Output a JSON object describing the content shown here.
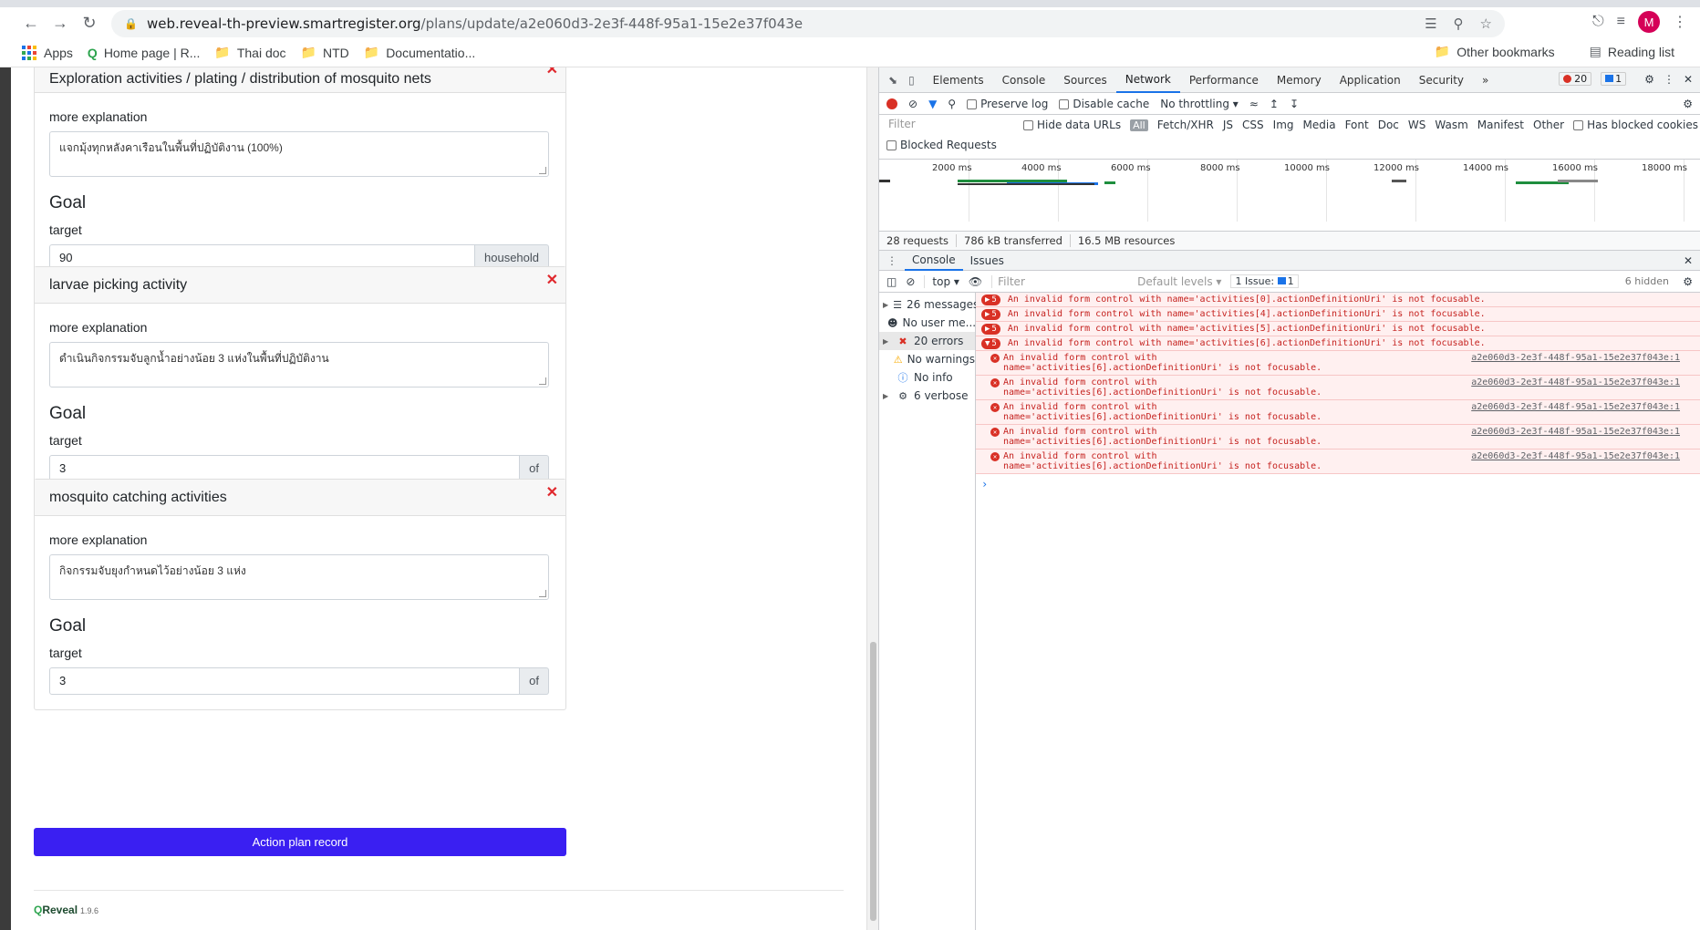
{
  "browser": {
    "url_host": "web.reveal-th-preview.smartregister.org",
    "url_path": "/plans/update/a2e060d3-2e3f-448f-95a1-15e2e37f043e",
    "profile_initial": "M",
    "bookmarks": [
      "Apps",
      "Home page | R...",
      "Thai doc",
      "NTD",
      "Documentatio..."
    ],
    "other_bookmarks": "Other bookmarks",
    "reading_list": "Reading list"
  },
  "page": {
    "activities": [
      {
        "title": "Exploration activities / plating / distribution of mosquito nets",
        "explanation_label": "more explanation",
        "explanation": "แจกมุ้งทุกหลังคาเรือนในพื้นที่ปฏิบัติงาน (100%)",
        "goal_label": "Goal",
        "target_label": "target",
        "target_value": "90",
        "unit": "household"
      },
      {
        "title": "larvae picking activity",
        "explanation_label": "more explanation",
        "explanation": "ดำเนินกิจกรรมจับลูกน้ำอย่างน้อย 3 แห่งในพื้นที่ปฏิบัติงาน",
        "goal_label": "Goal",
        "target_label": "target",
        "target_value": "3",
        "unit": "of"
      },
      {
        "title": "mosquito catching activities",
        "explanation_label": "more explanation",
        "explanation": "กิจกรรมจับยุงกำหนดไว้อย่างน้อย 3 แห่ง",
        "goal_label": "Goal",
        "target_label": "target",
        "target_value": "3",
        "unit": "of"
      }
    ],
    "submit_label": "Action plan record",
    "brand": "Reveal",
    "version": "1.9.6"
  },
  "devtools": {
    "tabs": [
      "Elements",
      "Console",
      "Sources",
      "Network",
      "Performance",
      "Memory",
      "Application",
      "Security"
    ],
    "active_tab": "Network",
    "error_count": "20",
    "message_count": "1",
    "network": {
      "preserve_log": "Preserve log",
      "disable_cache": "Disable cache",
      "throttling": "No throttling",
      "filter_placeholder": "Filter",
      "hide_data_urls": "Hide data URLs",
      "types": [
        "All",
        "Fetch/XHR",
        "JS",
        "CSS",
        "Img",
        "Media",
        "Font",
        "Doc",
        "WS",
        "Wasm",
        "Manifest",
        "Other"
      ],
      "has_blocked_cookies": "Has blocked cookies",
      "blocked_requests": "Blocked Requests",
      "timeline_labels": [
        "2000 ms",
        "4000 ms",
        "6000 ms",
        "8000 ms",
        "10000 ms",
        "12000 ms",
        "14000 ms",
        "16000 ms",
        "18000 ms"
      ],
      "requests": "28 requests",
      "transferred": "786 kB transferred",
      "resources": "16.5 MB resources"
    },
    "drawer_tabs": [
      "Console",
      "Issues"
    ],
    "console": {
      "context": "top",
      "filter_placeholder": "Filter",
      "levels": "Default levels",
      "issues": "1 Issue:",
      "issues_count": "1",
      "hidden": "6 hidden",
      "sidebar": [
        "26 messages",
        "No user me...",
        "20 errors",
        "No warnings",
        "No info",
        "6 verbose"
      ],
      "groups": [
        {
          "count": "5",
          "text": "An invalid form control with name='activities[0].actionDefinitionUri' is not focusable."
        },
        {
          "count": "5",
          "text": "An invalid form control with name='activities[4].actionDefinitionUri' is not focusable."
        },
        {
          "count": "5",
          "text": "An invalid form control with name='activities[5].actionDefinitionUri' is not focusable."
        },
        {
          "count": "5",
          "text": "An invalid form control with name='activities[6].actionDefinitionUri' is not focusable."
        }
      ],
      "error_line1": "An invalid form control with",
      "error_line2": "name='activities[6].actionDefinitionUri' is not focusable.",
      "error_source": "a2e060d3-2e3f-448f-95a1-15e2e37f043e:1",
      "error_rows": 5
    }
  },
  "colors": {
    "primary_button": "#3a1ff2",
    "close_x": "#e0282d",
    "error_text": "#c5221f",
    "error_bg": "#fff0f0"
  }
}
